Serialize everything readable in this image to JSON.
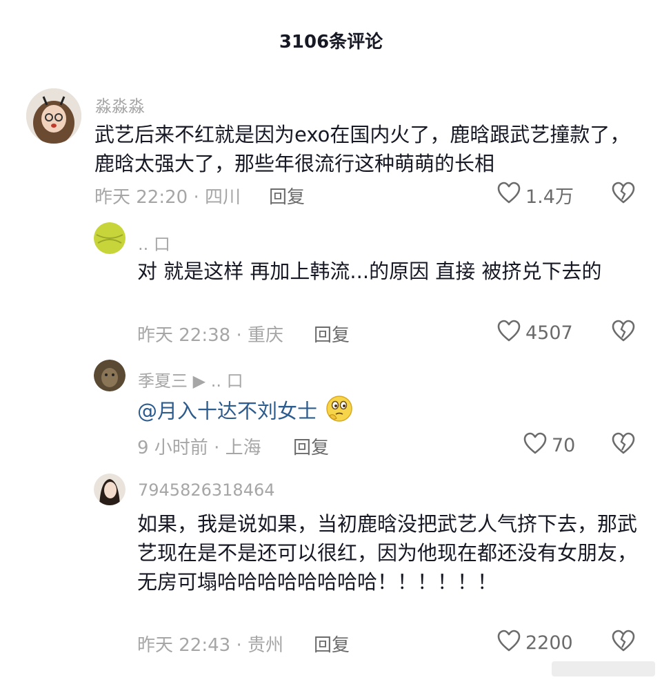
{
  "header": {
    "title": "3106条评论"
  },
  "comments": [
    {
      "username": "淼淼淼",
      "text": "武艺后来不红就是因为exo在国内火了，鹿晗跟武艺撞款了，鹿晗太强大了，那些年很流行这种萌萌的长相",
      "meta": "昨天 22:20 · 四川",
      "reply": "回复",
      "likes": "1.4万"
    },
    {
      "username": ".. 口",
      "text": "对 就是这样  再加上韩流...的原因 直接 被挤兑下去的",
      "meta": "昨天 22:38 · 重庆",
      "reply": "回复",
      "likes": "4507"
    },
    {
      "username": "季夏三 ▶ .. 口",
      "text": "@月入十达不刘女士",
      "meta": "9 小时前 · 上海",
      "reply": "回复",
      "likes": "70"
    },
    {
      "username": "7945826318464",
      "text": "如果，我是说如果，当初鹿晗没把武艺人气挤下去，那武艺现在是不是还可以很红，因为他现在都还没有女朋友，无房可塌哈哈哈哈哈哈哈哈！！！！！！",
      "meta": "昨天 22:43 · 贵州",
      "reply": "回复",
      "likes": "2200"
    }
  ],
  "icons": {
    "like": "heart-outline-icon",
    "dislike": "broken-heart-icon",
    "emoji": "thinking-face-icon"
  }
}
